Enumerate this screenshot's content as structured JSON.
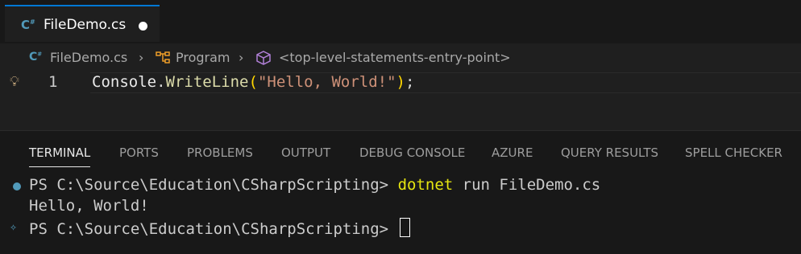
{
  "tab": {
    "label": "FileDemo.cs",
    "icon": "csharp-icon"
  },
  "breadcrumb": {
    "file": "FileDemo.cs",
    "class": "Program",
    "symbol": "<top-level-statements-entry-point>"
  },
  "code": {
    "line_number": "1",
    "class_name": "Console",
    "dot": ".",
    "method": "WriteLine",
    "open_paren": "(",
    "string": "\"Hello, World!\"",
    "close_paren": ")",
    "semicolon": ";"
  },
  "panel": {
    "tabs": [
      "TERMINAL",
      "PORTS",
      "PROBLEMS",
      "OUTPUT",
      "DEBUG CONSOLE",
      "AZURE",
      "QUERY RESULTS",
      "SPELL CHECKER"
    ],
    "active_tab": "TERMINAL"
  },
  "terminal": {
    "prompt1": "PS C:\\Source\\Education\\CSharpScripting> ",
    "cmd_word": "dotnet",
    "cmd_rest": " run FileDemo.cs",
    "output": "Hello, World!",
    "prompt2": "PS C:\\Source\\Education\\CSharpScripting> "
  },
  "colors": {
    "accent": "#0078d4",
    "csharp": "#519aba",
    "string": "#ce9178",
    "function": "#dcdcaa"
  }
}
